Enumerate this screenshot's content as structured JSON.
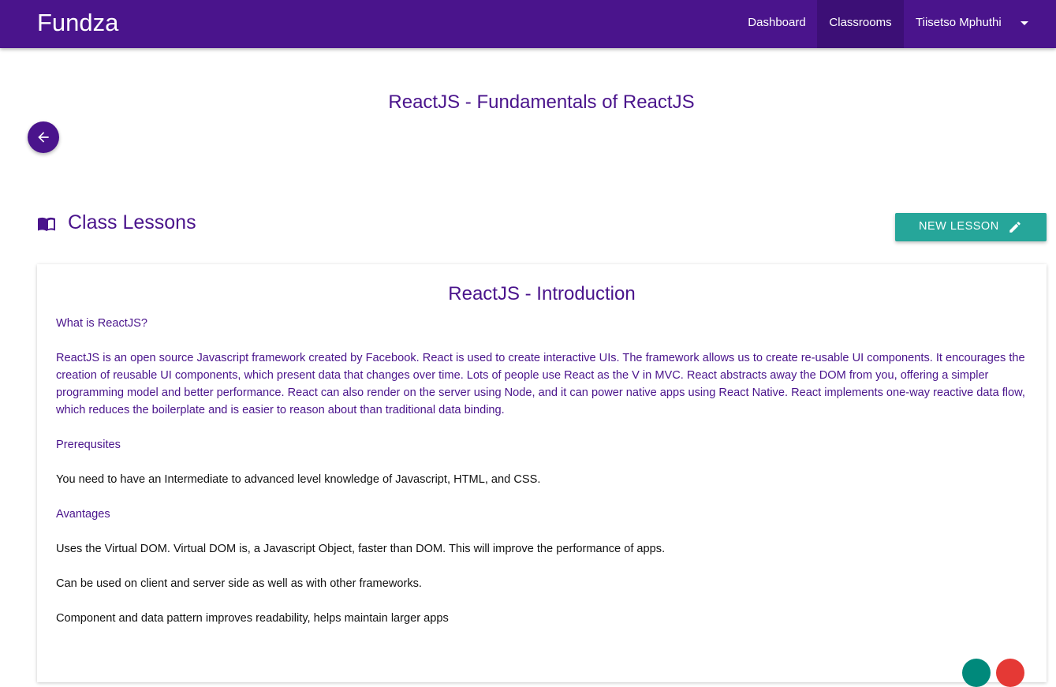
{
  "navbar": {
    "brand": "Fundza",
    "links": {
      "dashboard": "Dashboard",
      "classrooms": "Classrooms"
    },
    "user_name": "Tiisetso Mphuthi",
    "active_link": "Classrooms"
  },
  "page": {
    "course_title": "ReactJS - Fundamentals of ReactJS",
    "back_icon": "arrow-left-icon"
  },
  "section": {
    "icon": "book-icon",
    "title": "Class Lessons",
    "new_lesson_label": "NEW LESSON",
    "new_lesson_icon": "pencil-icon"
  },
  "lesson": {
    "title": "ReactJS - Introduction",
    "heading_what": "What is ReactJS?",
    "paragraph_what": "ReactJS is an open source Javascript framework created by Facebook. React is used to create interactive UIs.  The framework allows us to create re-usable UI components. It encourages the creation of reusable UI components, which present data that changes over time. Lots of people use React as the V in MVC. React abstracts away the DOM from you, offering a simpler programming model and better performance. React can also render on the server using Node, and it can power native apps using React Native. React implements one-way reactive data flow, which reduces the boilerplate and is easier to reason about than traditional data binding.",
    "heading_prerequisites": "Prerequsites",
    "paragraph_prerequisites": "You need to have an Intermediate to advanced level knowledge of Javascript, HTML, and CSS.",
    "heading_advantages": "Avantages",
    "advantages": [
      "Uses the Virtual DOM. Virtual DOM is, a Javascript Object, faster than DOM.  This will improve the performance of apps.",
      "Can be used on client and server side as well as with other frameworks.",
      "Component and data pattern improves readability, helps maintain larger apps"
    ]
  },
  "colors": {
    "primary": "#4a148c",
    "accent": "#26a69a",
    "danger": "#e53935"
  }
}
